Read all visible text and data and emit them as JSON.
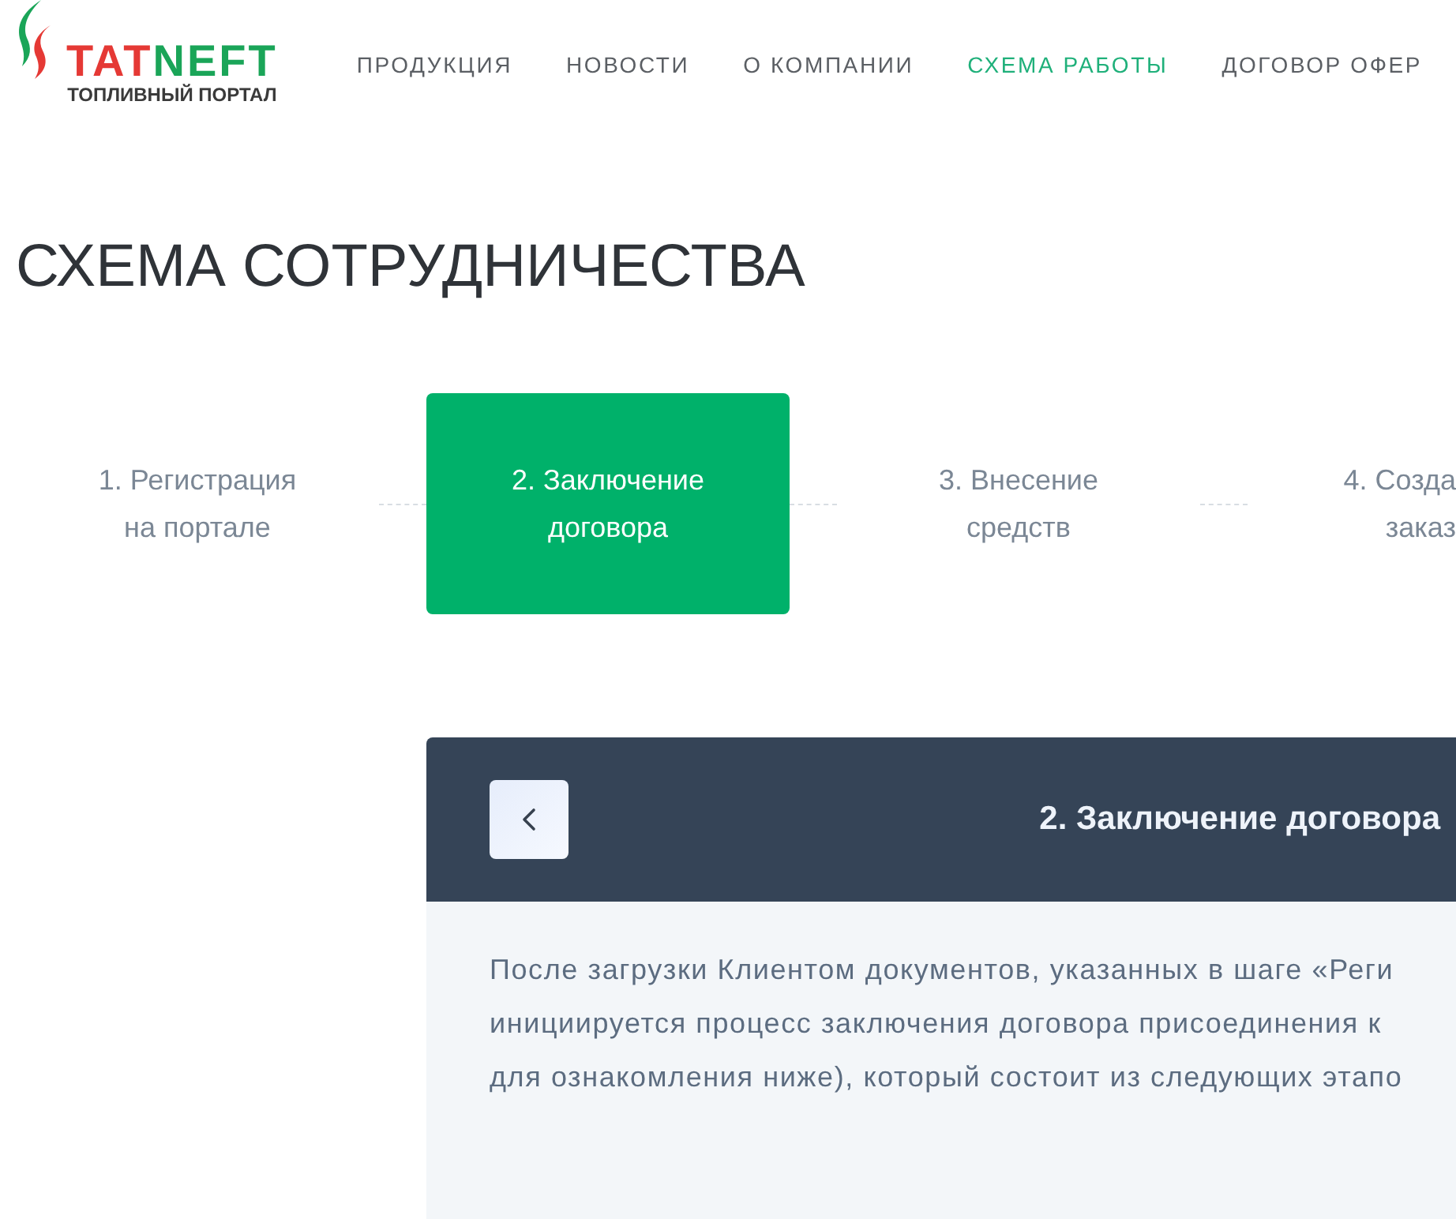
{
  "logo": {
    "wordmark": [
      "TAT",
      "NEFT"
    ],
    "subtitle": "ТОПЛИВНЫЙ ПОРТАЛ"
  },
  "nav": [
    {
      "label": "ПРОДУКЦИЯ",
      "selected": false
    },
    {
      "label": "НОВОСТИ",
      "selected": false
    },
    {
      "label": "О КОМПАНИИ",
      "selected": false
    },
    {
      "label": "СХЕМА РАБОТЫ",
      "selected": true
    },
    {
      "label": "ДОГОВОР ОФЕР",
      "selected": false
    }
  ],
  "page_title": "СХЕМА СОТРУДНИЧЕСТВА",
  "steps": [
    {
      "label": "1. Регистрация\nна портале",
      "selected": false
    },
    {
      "label": "2. Заключение\nдоговора",
      "selected": true
    },
    {
      "label": "3. Внесение\nсредств",
      "selected": false
    },
    {
      "label": "4. Созда\nзаказ",
      "selected": false
    }
  ],
  "step_card": {
    "title": "2. Заключение договора",
    "text": "После загрузки Клиентом документов, указанных в шаге «Реги\nинициируется процесс заключения договора присоединения к\nдля ознакомления ниже), который состоит из следующих этапо"
  }
}
